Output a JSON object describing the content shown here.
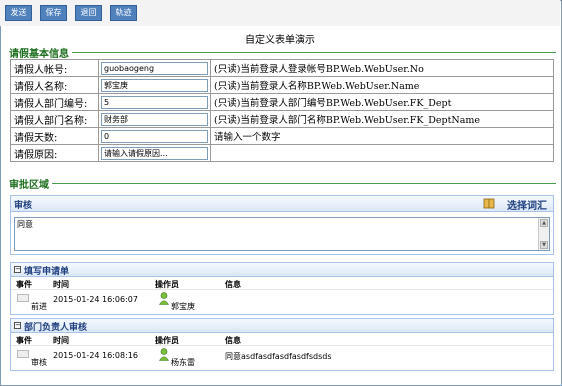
{
  "toolbar": {
    "buttons": [
      "发送",
      "保存",
      "退回",
      "轨迹"
    ]
  },
  "form_title": "自定义表单演示",
  "section_basic": "请假基本信息",
  "fields": [
    {
      "label": "请假人帐号:",
      "value": "guobaogeng",
      "note": "(只读)当前登录人登录帐号BP.Web.WebUser.No"
    },
    {
      "label": "请假人名称:",
      "value": "郭宝庚",
      "note": "(只读)当前登录人名称BP.Web.WebUser.Name"
    },
    {
      "label": "请假人部门编号:",
      "value": "5",
      "note": "(只读)当前登录人部门编号BP.Web.WebUser.FK_Dept"
    },
    {
      "label": "请假人部门名称:",
      "value": "财务部",
      "note": "(只读)当前登录人部门名称BP.Web.WebUser.FK_DeptName"
    },
    {
      "label": "请假天数:",
      "value": "0",
      "note": "请输入一个数字"
    },
    {
      "label": "请假原因:",
      "value": "请输入请假原因...",
      "note": ""
    }
  ],
  "section_approval": "审批区域",
  "review": {
    "title": "审核",
    "vocab_link": "选择词汇",
    "text": "同意"
  },
  "columns": {
    "event": "事件",
    "time": "时间",
    "operator": "操作员",
    "info": "信息"
  },
  "tracks": [
    {
      "title": "填写申请单",
      "event": "前进",
      "time": "2015-01-24 16:06:07",
      "operator": "郭宝庚",
      "info": ""
    },
    {
      "title": "部门负责人审核",
      "event": "审核",
      "time": "2015-01-24 16:08:16",
      "operator": "杨东雷",
      "info": "同意asdfasdfasdfasdfsdsds"
    }
  ]
}
